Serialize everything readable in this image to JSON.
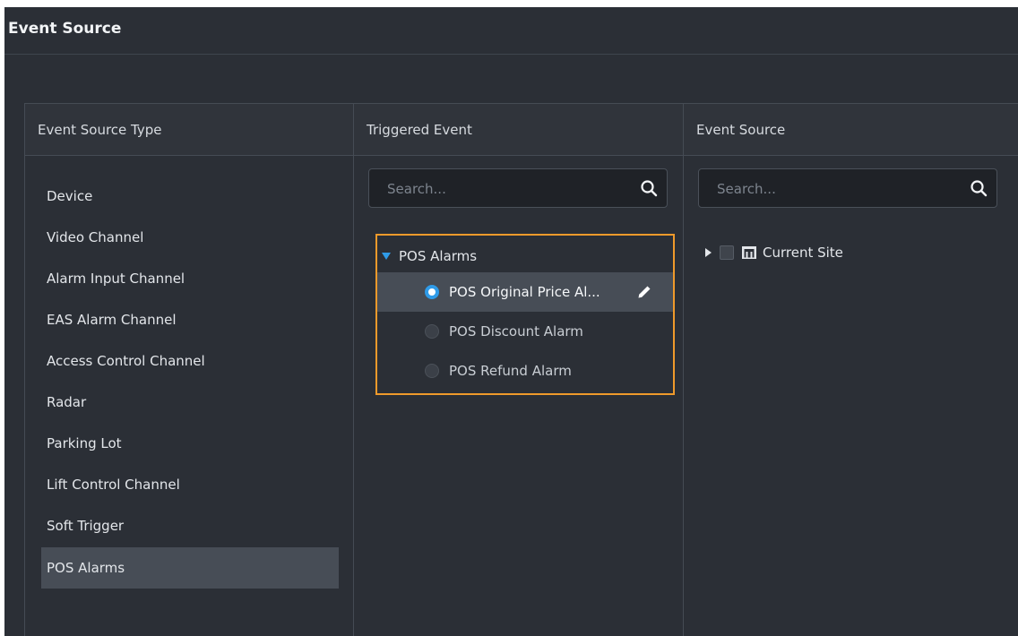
{
  "header": {
    "title": "Event Source"
  },
  "panels": {
    "source_type": {
      "header": "Event Source Type",
      "items": [
        {
          "label": "Device"
        },
        {
          "label": "Video Channel"
        },
        {
          "label": "Alarm Input Channel"
        },
        {
          "label": "EAS Alarm Channel"
        },
        {
          "label": "Access Control Channel"
        },
        {
          "label": "Radar"
        },
        {
          "label": "Parking Lot"
        },
        {
          "label": "Lift Control Channel"
        },
        {
          "label": "Soft Trigger"
        },
        {
          "label": "POS Alarms",
          "selected": true
        }
      ]
    },
    "triggered_event": {
      "header": "Triggered Event",
      "search": {
        "placeholder": "Search...",
        "value": ""
      },
      "group": {
        "label": "POS Alarms",
        "expanded": true
      },
      "events": [
        {
          "label": "POS Original Price Al...",
          "selected": true
        },
        {
          "label": "POS Discount Alarm",
          "selected": false
        },
        {
          "label": "POS Refund Alarm",
          "selected": false
        }
      ]
    },
    "event_source": {
      "header": "Event Source",
      "search": {
        "placeholder": "Search...",
        "value": ""
      },
      "tree": [
        {
          "label": "Current Site",
          "checked": false,
          "expanded": false,
          "icon": "site-icon"
        }
      ]
    }
  },
  "colors": {
    "background": "#2b2f36",
    "selected_row": "#474d56",
    "accent_blue": "#2f9be8",
    "highlight_orange": "#ef9a2b"
  }
}
